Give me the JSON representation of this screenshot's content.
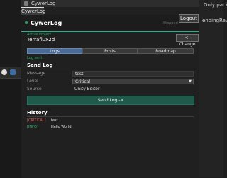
{
  "right_panel": {
    "lines": [
      "Only packa",
      "endingRevie"
    ]
  },
  "window": {
    "title": "CywerLog",
    "tab": "CywerLog",
    "logout": "Logout",
    "brand": "CywerLog",
    "status": "Stopped"
  },
  "project": {
    "label": "Active Project",
    "name": "Terraflux2d",
    "change": "<- Change"
  },
  "nav": {
    "tabs": [
      "Logs",
      "Posts",
      "Roadmap"
    ],
    "active": "Logs"
  },
  "send_log": {
    "sent_status": "Log sent!",
    "title": "Send Log",
    "message_label": "Message",
    "message_value": "test",
    "level_label": "Level",
    "level_value": "Critical",
    "source_label": "Source",
    "source_value": "Unity Editor",
    "send_button": "Send Log ->"
  },
  "history": {
    "title": "History",
    "items": [
      {
        "level": "[CRITICAL]",
        "message": "test",
        "color": "#d9534f"
      },
      {
        "level": "[INFO]",
        "message": "Hello World!",
        "color": "#3bb371"
      }
    ]
  }
}
